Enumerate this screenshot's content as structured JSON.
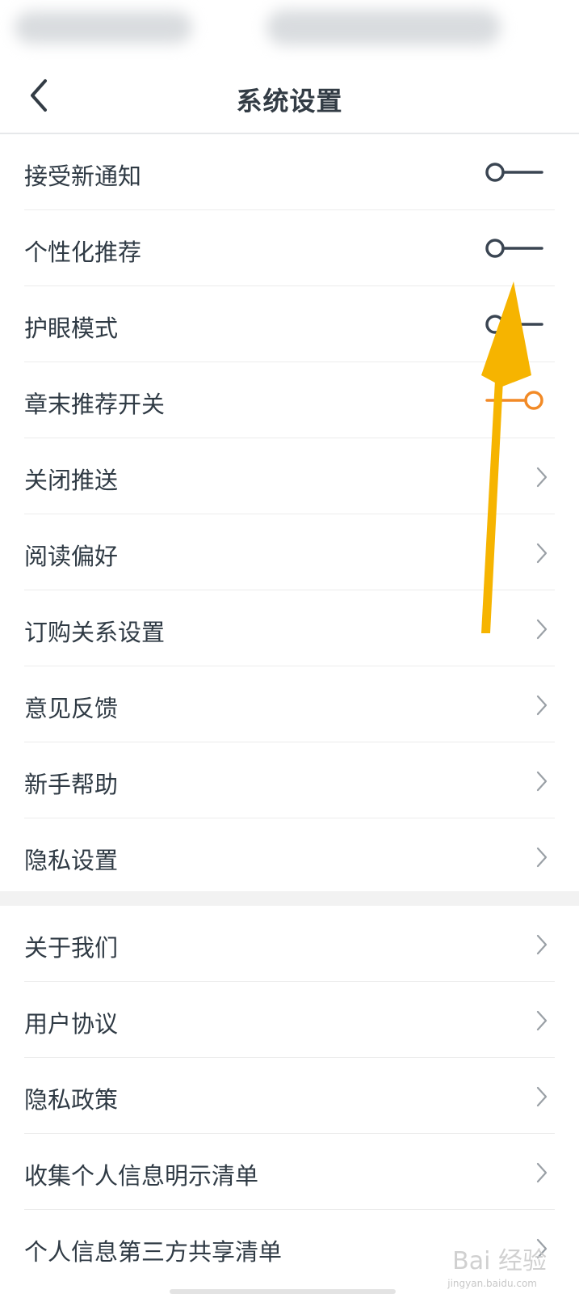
{
  "header": {
    "title": "系统设置",
    "back_icon": "back-arrow-icon"
  },
  "toggles": [
    {
      "label": "接受新通知",
      "state": "off"
    },
    {
      "label": "个性化推荐",
      "state": "off"
    },
    {
      "label": "护眼模式",
      "state": "off"
    },
    {
      "label": "章末推荐开关",
      "state": "on"
    }
  ],
  "settings_links": [
    {
      "label": "关闭推送"
    },
    {
      "label": "阅读偏好"
    },
    {
      "label": "订购关系设置"
    },
    {
      "label": "意见反馈"
    },
    {
      "label": "新手帮助"
    },
    {
      "label": "隐私设置"
    }
  ],
  "about_links": [
    {
      "label": "关于我们"
    },
    {
      "label": "用户协议"
    },
    {
      "label": "隐私政策"
    },
    {
      "label": "收集个人信息明示清单"
    },
    {
      "label": "个人信息第三方共享清单"
    }
  ],
  "colors": {
    "toggle_off": "#3a4552",
    "toggle_on": "#f28a26",
    "annotation_arrow": "#f6b400"
  },
  "watermark": {
    "text": "Bai 经验",
    "sub": "jingyan.baidu.com"
  }
}
